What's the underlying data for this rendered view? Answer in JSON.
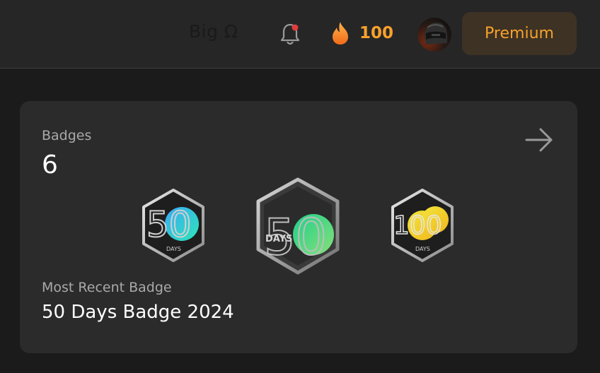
{
  "header": {
    "brand": "Big Ω",
    "streak_count": "100",
    "premium_label": "Premium",
    "has_notification_dot": true,
    "icons": {
      "notification": "bell-icon",
      "streak": "flame-icon",
      "avatar": "helmet-avatar"
    }
  },
  "badges_card": {
    "title": "Badges",
    "count": "6",
    "recent_label": "Most Recent Badge",
    "recent_value": "50 Days Badge 2024",
    "badges": [
      {
        "number": "50",
        "caption": "DAYS",
        "fill": "cyan-gradient"
      },
      {
        "number": "50",
        "caption": "DAYS",
        "fill": "green-gradient"
      },
      {
        "number": "100",
        "caption": "DAYS",
        "fill": "yellow-gradient"
      }
    ]
  },
  "colors": {
    "background": "#1b1b1b",
    "topbar": "#262626",
    "card": "#2b2b2b",
    "accent": "#f7a12c",
    "premium_bg": "#3d3224",
    "muted_text": "#a9a9a9",
    "notification_dot": "#e23b3b"
  }
}
